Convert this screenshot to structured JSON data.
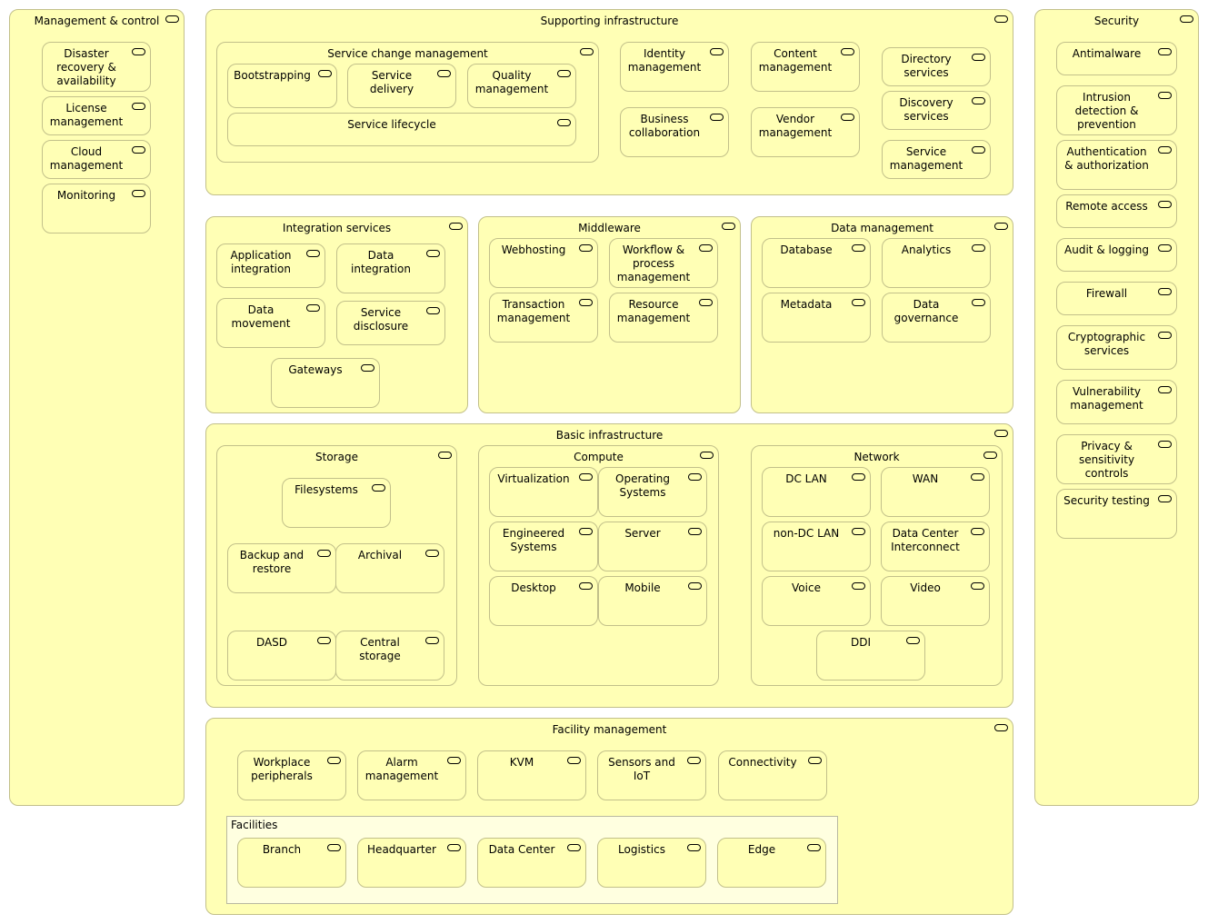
{
  "colors": {
    "element_fill": "#ffffb5",
    "element_border": "#c2c08a",
    "group_fill": "#ffffe0"
  },
  "icon": "business-service-icon",
  "elements": {
    "mgmt": "Management & control",
    "disaster": "Disaster\nrecovery &\navailability",
    "license": "License\nmanagement",
    "cloud": "Cloud\nmanagement",
    "monitoring": "Monitoring",
    "supinfra": "Supporting infrastructure",
    "svcchg": "Service change management",
    "bootstrapping": "Bootstrapping",
    "svcdelivery": "Service\ndelivery",
    "quality": "Quality\nmanagement",
    "lifecycle": "Service lifecycle",
    "identity": "Identity\nmanagement",
    "content": "Content\nmanagement",
    "directory": "Directory\nservices",
    "discovery": "Discovery\nservices",
    "svcmgmt": "Service\nmanagement",
    "business": "Business\ncollaboration",
    "vendor": "Vendor\nmanagement",
    "security": "Security",
    "antimalware": "Antimalware",
    "intrusion": "Intrusion\ndetection &\nprevention",
    "auth": "Authentication\n& authorization",
    "remote": "Remote access",
    "audit": "Audit & logging",
    "firewall": "Firewall",
    "crypto": "Cryptographic\nservices",
    "vuln": "Vulnerability\nmanagement",
    "privacy": "Privacy &\nsensitivity\ncontrols",
    "sectest": "Security testing",
    "integration": "Integration services",
    "appint": "Application\nintegration",
    "dataint": "Data\nintegration",
    "datamove": "Data\nmovement",
    "disclosure": "Service\ndisclosure",
    "gateways": "Gateways",
    "middleware": "Middleware",
    "webhosting": "Webhosting",
    "workflow": "Workflow &\nprocess\nmanagement",
    "transaction": "Transaction\nmanagement",
    "resource": "Resource\nmanagement",
    "datamgmt": "Data management",
    "database": "Database",
    "analytics": "Analytics",
    "metadata": "Metadata",
    "governance": "Data\ngovernance",
    "basic": "Basic infrastructure",
    "storage": "Storage",
    "filesystems": "Filesystems",
    "backup": "Backup and\nrestore",
    "archival": "Archival",
    "dasd": "DASD",
    "central": "Central\nstorage",
    "compute": "Compute",
    "virt": "Virtualization",
    "os": "Operating\nSystems",
    "engineered": "Engineered\nSystems",
    "server": "Server",
    "desktop": "Desktop",
    "mobile": "Mobile",
    "network": "Network",
    "dclan": "DC LAN",
    "wan": "WAN",
    "nondclan": "non-DC LAN",
    "dci": "Data Center\nInterconnect",
    "voice": "Voice",
    "video": "Video",
    "ddi": "DDI",
    "facility": "Facility management",
    "workplace": "Workplace\nperipherals",
    "alarm": "Alarm\nmanagement",
    "kvm": "KVM",
    "sensors": "Sensors and\nIoT",
    "connectivity": "Connectivity",
    "facilities": "Facilities",
    "branch": "Branch",
    "hq": "Headquarter",
    "datacenter": "Data Center",
    "logistics": "Logistics",
    "edge": "Edge"
  }
}
